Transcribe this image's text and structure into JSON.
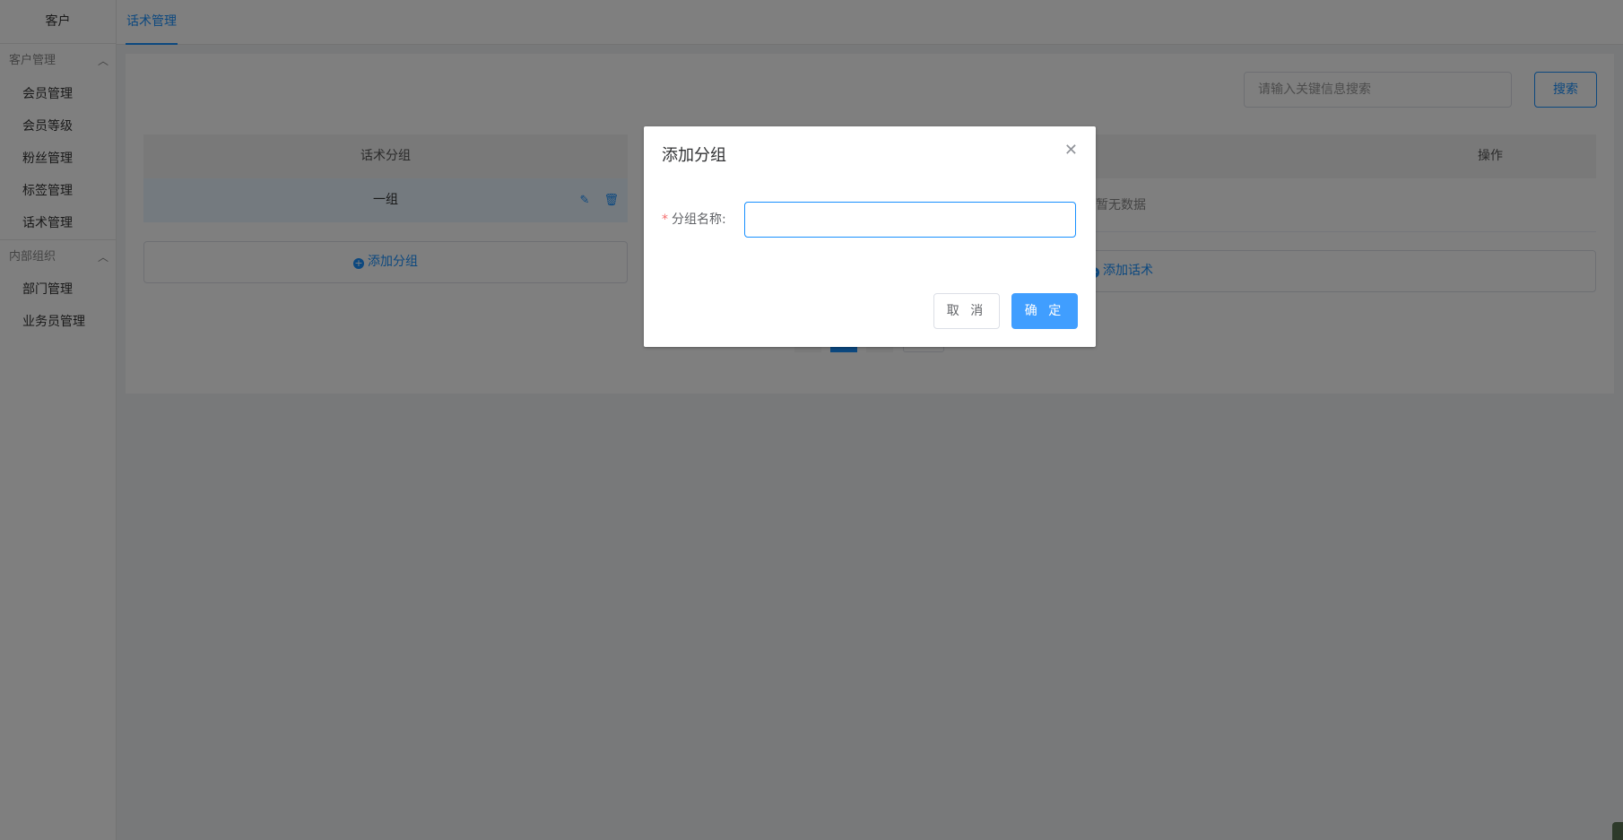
{
  "sidebar": {
    "title": "客户",
    "groups": [
      {
        "title": "客户管理",
        "items": [
          "会员管理",
          "会员等级",
          "粉丝管理",
          "标签管理",
          "话术管理"
        ]
      },
      {
        "title": "内部组织",
        "items": [
          "部门管理",
          "业务员管理"
        ]
      }
    ]
  },
  "tabs": {
    "active": "话术管理"
  },
  "search": {
    "placeholder": "请输入关键信息搜索",
    "button": "搜索"
  },
  "left_table": {
    "header": "话术分组",
    "rows": [
      {
        "name": "一组"
      }
    ],
    "add_button": "添加分组"
  },
  "right_table": {
    "header_op": "操作",
    "empty_text": "暂无数据",
    "add_button": "添加话术"
  },
  "dialog": {
    "title": "添加分组",
    "field_label": "分组名称:",
    "field_required_mark": "*",
    "cancel": "取 消",
    "confirm": "确 定"
  },
  "colors": {
    "primary": "#1890ff",
    "overlay": "rgba(0,0,0,0.5)"
  }
}
